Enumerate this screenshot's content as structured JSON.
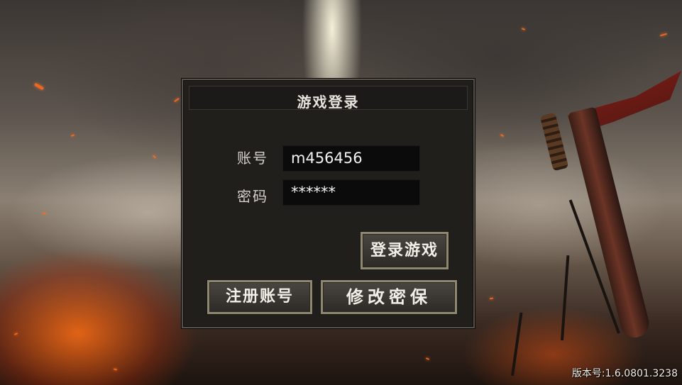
{
  "login_dialog": {
    "title": "游戏登录",
    "account_label": "账号",
    "account_value": "m456456",
    "password_label": "密码",
    "password_value": "******",
    "login_button": "登录游戏",
    "register_button": "注册账号",
    "change_security_button": "修改密保"
  },
  "version_text": "版本号:1.6.0801.3238",
  "colors": {
    "panel_bg": "#211f1c",
    "panel_border": "#56504a",
    "button_border": "#8f8770",
    "field_bg": "#0b0b0b",
    "text": "#f2efe8"
  }
}
